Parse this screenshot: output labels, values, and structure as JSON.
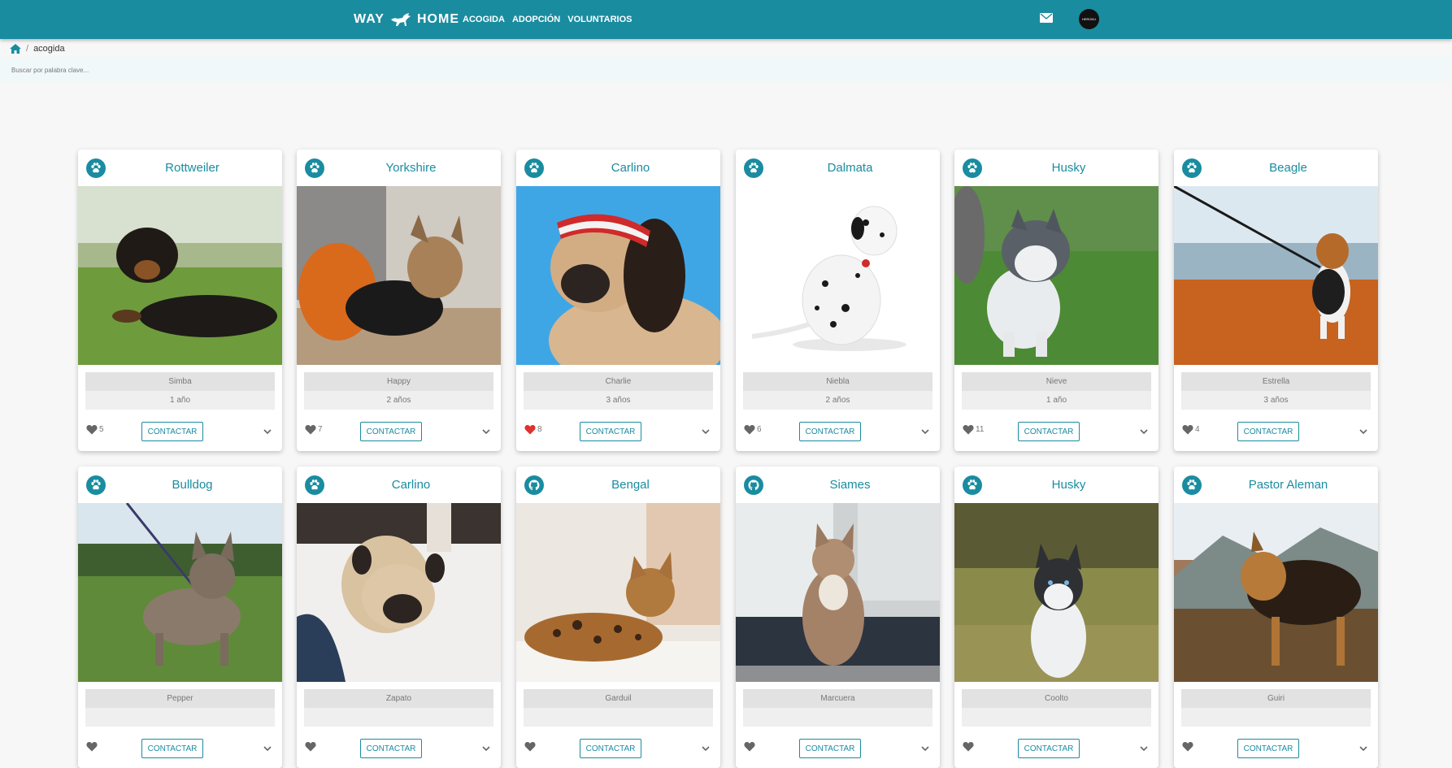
{
  "nav": {
    "brand_left": "WAY",
    "brand_right": "HOME",
    "links": [
      "ACOGIDA",
      "ADOPCIÓN",
      "VOLUNTARIOS"
    ],
    "mail_icon": "mail-icon",
    "avatar_text": "HEROKU"
  },
  "breadcrumb": {
    "home_icon": "home-icon",
    "separator": "/",
    "current": "acogida"
  },
  "search": {
    "placeholder": "Buscar por palabra clave..."
  },
  "colors": {
    "primary": "#1a8ca0",
    "liked": "#e03030",
    "heart": "#666666"
  },
  "cards": [
    {
      "breed": "Rottweiler",
      "name": "Simba",
      "age": "1 año",
      "likes": "5",
      "liked": false,
      "icon": "paw-icon",
      "button": "CONTACTAR"
    },
    {
      "breed": "Yorkshire",
      "name": "Happy",
      "age": "2 años",
      "likes": "7",
      "liked": false,
      "icon": "paw-icon",
      "button": "CONTACTAR"
    },
    {
      "breed": "Carlino",
      "name": "Charlie",
      "age": "3 años",
      "likes": "8",
      "liked": true,
      "icon": "paw-icon",
      "button": "CONTACTAR"
    },
    {
      "breed": "Dalmata",
      "name": "Niebla",
      "age": "2 años",
      "likes": "6",
      "liked": false,
      "icon": "paw-icon",
      "button": "CONTACTAR"
    },
    {
      "breed": "Husky",
      "name": "Nieve",
      "age": "1 año",
      "likes": "11",
      "liked": false,
      "icon": "paw-icon",
      "button": "CONTACTAR"
    },
    {
      "breed": "Beagle",
      "name": "Estrella",
      "age": "3 años",
      "likes": "4",
      "liked": false,
      "icon": "paw-icon",
      "button": "CONTACTAR"
    },
    {
      "breed": "Bulldog",
      "name": "Pepper",
      "age": "",
      "likes": "",
      "liked": false,
      "icon": "paw-icon",
      "button": "CONTACTAR"
    },
    {
      "breed": "Carlino",
      "name": "Zapato",
      "age": "",
      "likes": "",
      "liked": false,
      "icon": "paw-icon",
      "button": "CONTACTAR"
    },
    {
      "breed": "Bengal",
      "name": "Garduil",
      "age": "",
      "likes": "",
      "liked": false,
      "icon": "cat-icon",
      "button": "CONTACTAR"
    },
    {
      "breed": "Siames",
      "name": "Marcuera",
      "age": "",
      "likes": "",
      "liked": false,
      "icon": "cat-icon",
      "button": "CONTACTAR"
    },
    {
      "breed": "Husky",
      "name": "Coolto",
      "age": "",
      "likes": "",
      "liked": false,
      "icon": "paw-icon",
      "button": "CONTACTAR"
    },
    {
      "breed": "Pastor Aleman",
      "name": "Guiri",
      "age": "",
      "likes": "",
      "liked": false,
      "icon": "paw-icon",
      "button": "CONTACTAR"
    }
  ]
}
